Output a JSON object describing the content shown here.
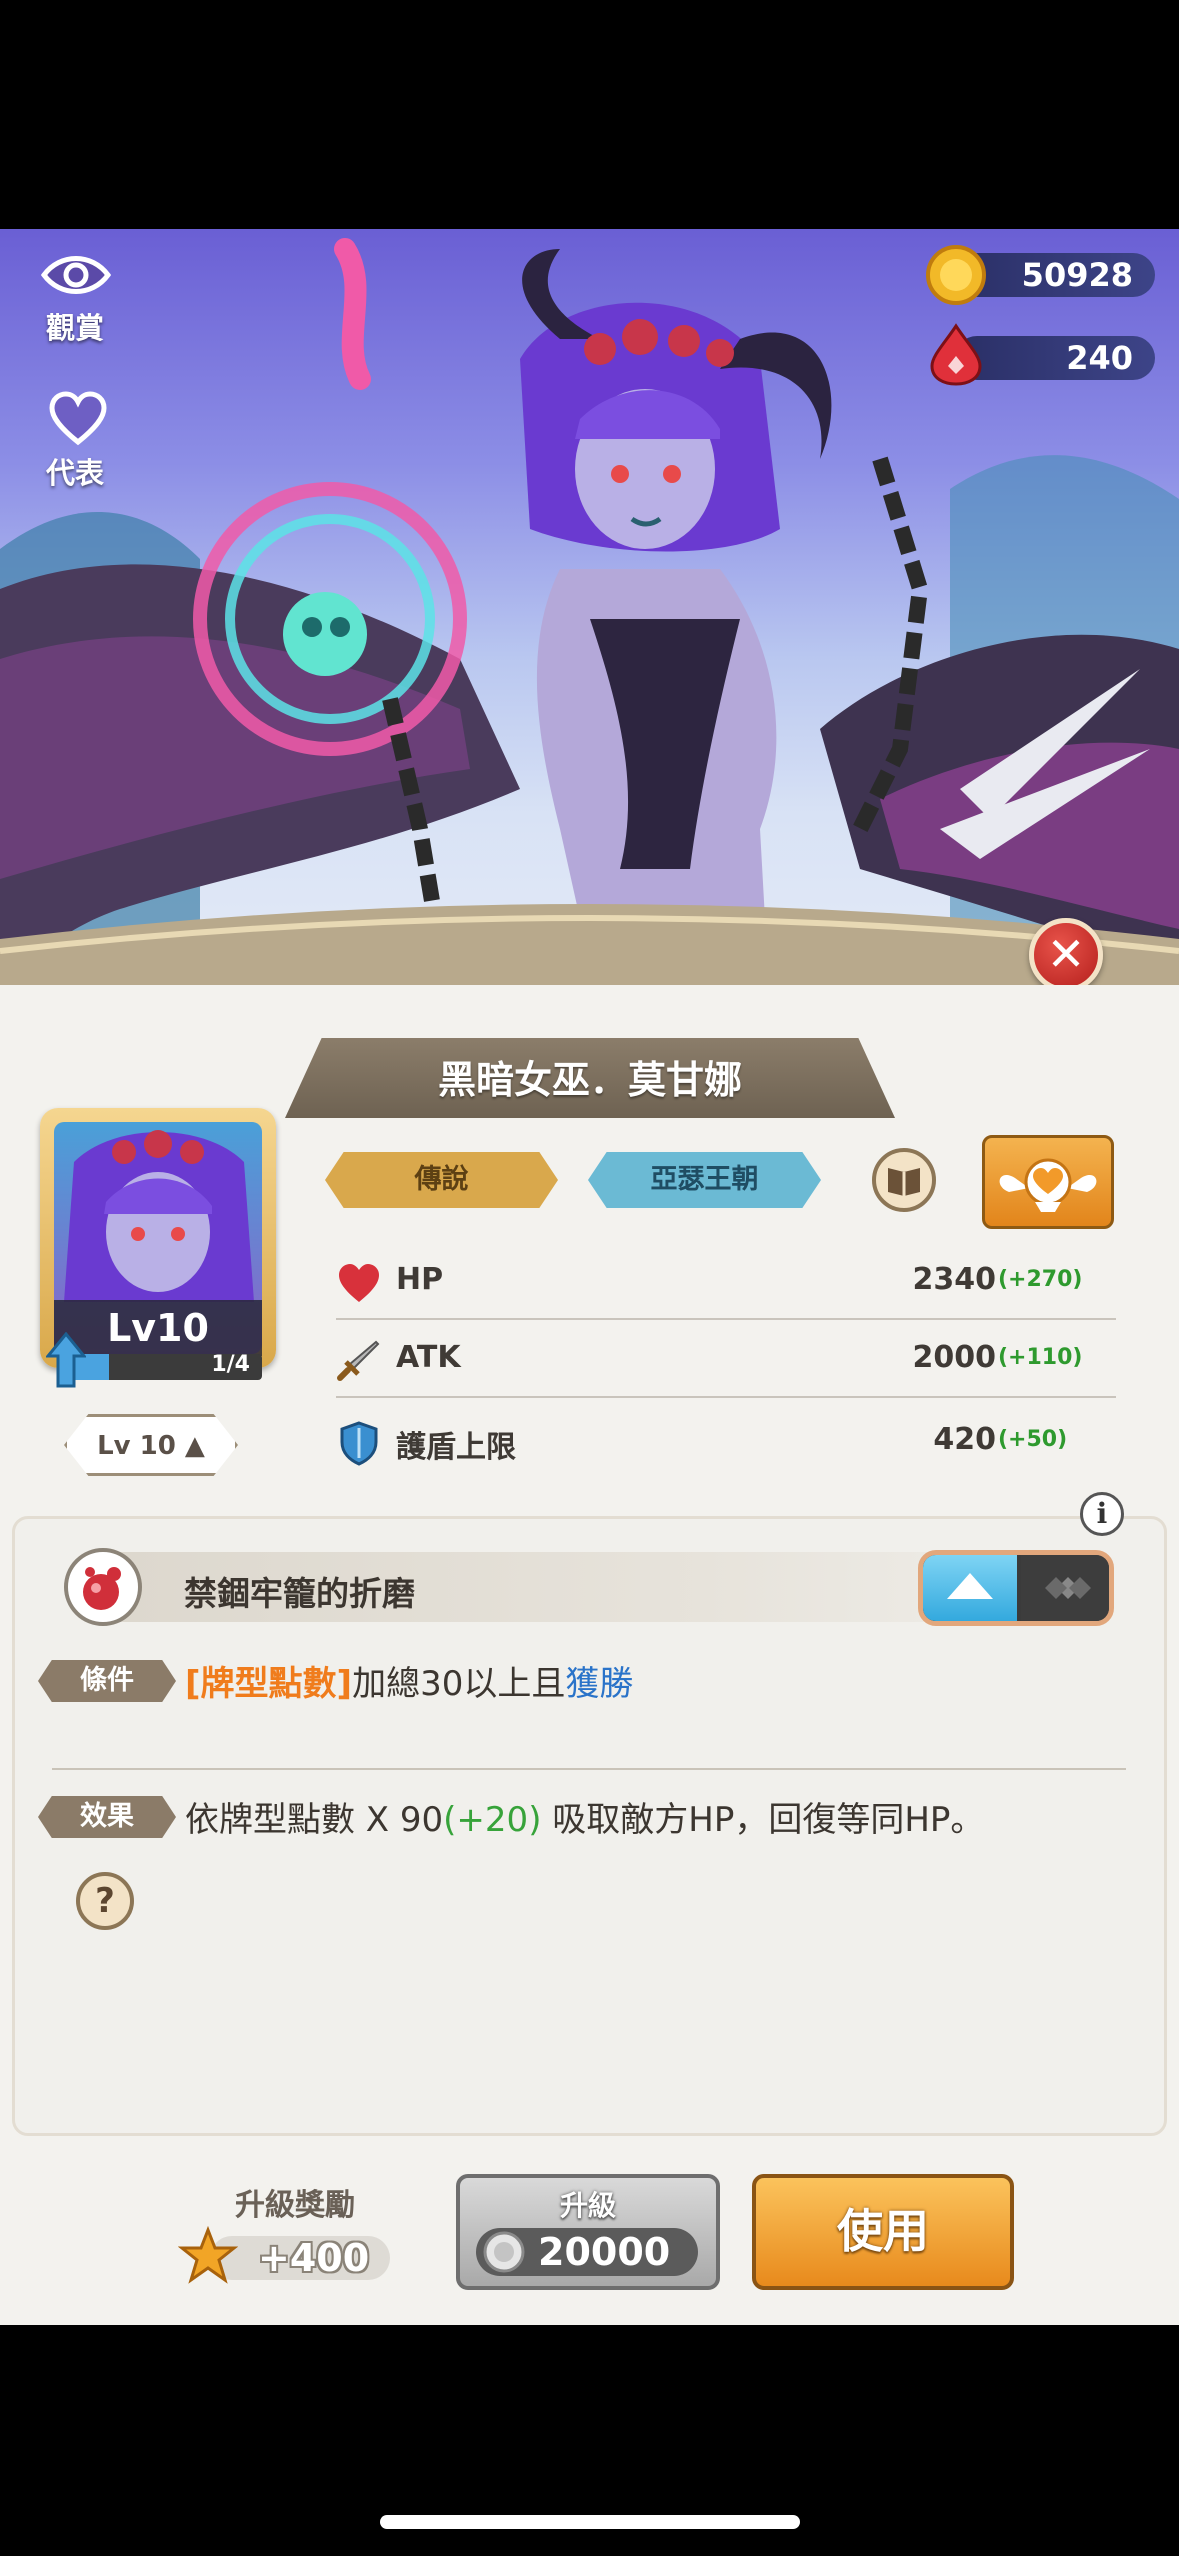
{
  "top_left": {
    "view_label": "觀賞",
    "represent_label": "代表"
  },
  "currency": {
    "gold": "50928",
    "gems": "240"
  },
  "hero": {
    "name": "黑暗女巫．莫甘娜"
  },
  "portrait": {
    "level_label": "Lv10",
    "exp_text": "1/4",
    "exp_fraction": 0.25
  },
  "level_selector": "Lv 10 ▲",
  "tags": {
    "rarity": "傳說",
    "faction": "亞瑟王朝"
  },
  "stats": [
    {
      "label": "HP",
      "value": "2340",
      "bonus": "(+270)",
      "icon": "heart-icon"
    },
    {
      "label": "ATK",
      "value": "2000",
      "bonus": "(+110)",
      "icon": "sword-icon"
    },
    {
      "label": "護盾上限",
      "value": "420",
      "bonus": "(+50)",
      "icon": "shield-icon"
    }
  ],
  "skill": {
    "info_glyph": "i",
    "name": "禁錮牢籠的折磨",
    "condition_tag": "條件",
    "condition_highlight": "[牌型點數]",
    "condition_mid": "加總30以上且",
    "condition_end": "獲勝",
    "effect_tag": "效果",
    "effect_pre": "依牌型點數 X 90",
    "effect_bonus": "(+20)",
    "effect_post": " 吸取敵方HP，回復等同HP。",
    "help_glyph": "?"
  },
  "bottom": {
    "reward_label": "升級獎勵",
    "reward_value": "+400",
    "upgrade_label": "升級",
    "upgrade_cost": "20000",
    "use_label": "使用"
  },
  "colors": {
    "accent_orange": "#f07c1c",
    "accent_blue": "#2a73c9",
    "bonus_green": "#2e9a2e"
  }
}
